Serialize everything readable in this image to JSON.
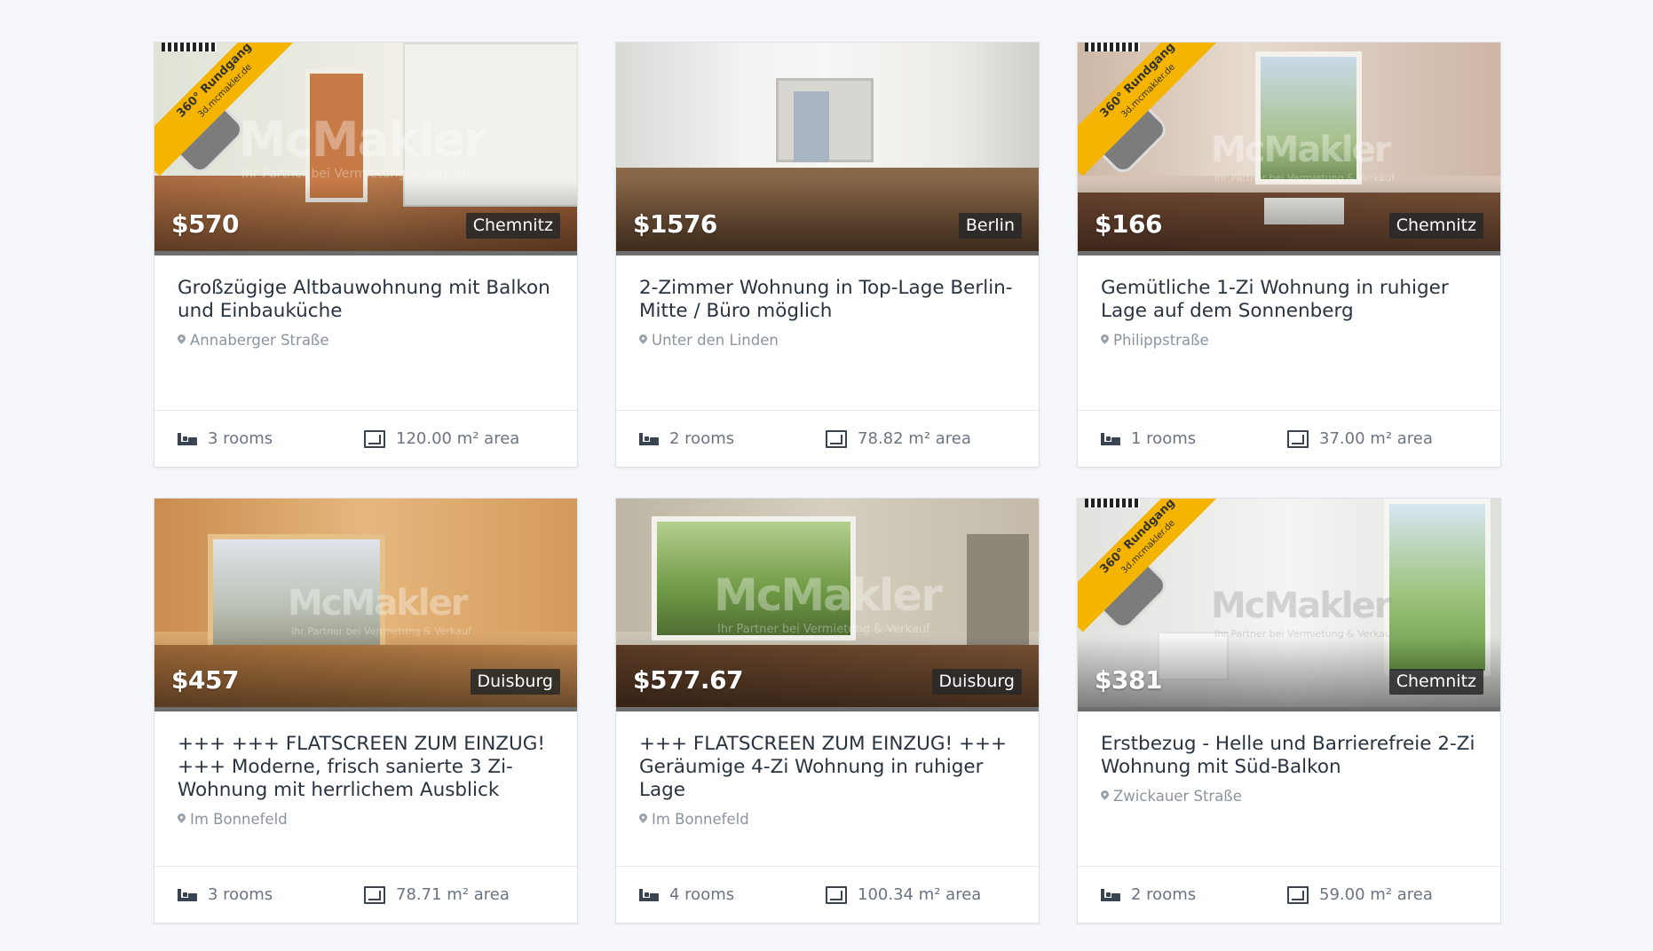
{
  "colors": {
    "badge_yellow": "#f5b400",
    "city_badge_bg": "#282828",
    "page_bg": "#f5f7fa"
  },
  "listings": [
    {
      "price": "$570",
      "city": "Chemnitz",
      "title": "Großzügige Altbauwohnung mit Balkon und Einbauküche",
      "address": "Annaberger Straße",
      "rooms": "3 rooms",
      "area": "120.00 m² area",
      "watermark": "McMakler",
      "watermark_sub": "Ihr Partner bei Vermietung & Verkauf",
      "badge_360": "360° Rundgang",
      "badge_360_url": "3d.mcmakler.de"
    },
    {
      "price": "$1576",
      "city": "Berlin",
      "title": "2-Zimmer Wohnung in Top-Lage Berlin-Mitte / Büro möglich",
      "address": "Unter den Linden",
      "rooms": "2 rooms",
      "area": "78.82 m² area"
    },
    {
      "price": "$166",
      "city": "Chemnitz",
      "title": "Gemütliche 1-Zi Wohnung in ruhiger Lage auf dem Sonnenberg",
      "address": "Philippstraße",
      "rooms": "1 rooms",
      "area": "37.00 m² area",
      "watermark": "McMakler",
      "watermark_sub": "Ihr Partner bei Vermietung & Verkauf",
      "badge_360": "360° Rundgang",
      "badge_360_url": "3d.mcmakler.de"
    },
    {
      "price": "$457",
      "city": "Duisburg",
      "title": "+++ +++ FLATSCREEN ZUM EINZUG! +++ Moderne, frisch sanierte 3 Zi-Wohnung mit herrlichem Ausblick",
      "address": "Im Bonnefeld",
      "rooms": "3 rooms",
      "area": "78.71 m² area",
      "watermark": "McMakler",
      "watermark_sub": "Ihr Partner bei Vermietung & Verkauf"
    },
    {
      "price": "$577.67",
      "city": "Duisburg",
      "title": "+++ FLATSCREEN ZUM EINZUG! +++ Geräumige 4-Zi Wohnung in ruhiger Lage",
      "address": "Im Bonnefeld",
      "rooms": "4 rooms",
      "area": "100.34 m² area",
      "watermark": "McMakler",
      "watermark_sub": "Ihr Partner bei Vermietung & Verkauf"
    },
    {
      "price": "$381",
      "city": "Chemnitz",
      "title": "Erstbezug - Helle und Barrierefreie 2-Zi Wohnung mit Süd-Balkon",
      "address": "Zwickauer Straße",
      "rooms": "2 rooms",
      "area": "59.00 m² area",
      "watermark": "McMakler",
      "watermark_sub": "Ihr Partner bei Vermietung & Verkauf",
      "badge_360": "360° Rundgang",
      "badge_360_url": "3d.mcmakler.de"
    }
  ]
}
